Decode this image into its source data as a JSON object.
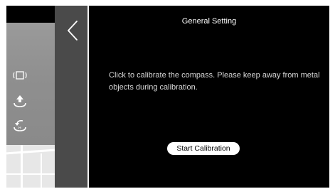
{
  "header": {
    "title": "General Setting",
    "back_icon": "chevron-left-icon"
  },
  "calibration": {
    "message": "Click to calibrate the compass. Please keep away from metal objects during calibration.",
    "start_label": "Start Calibration"
  },
  "sidebar_icons": [
    "gimbal-icon",
    "takeoff-icon",
    "return-home-icon"
  ],
  "colors": {
    "panel_bg": "#000000",
    "back_strip_bg": "#4a4a4a",
    "button_bg": "#ffffff",
    "text": "#ffffff"
  }
}
